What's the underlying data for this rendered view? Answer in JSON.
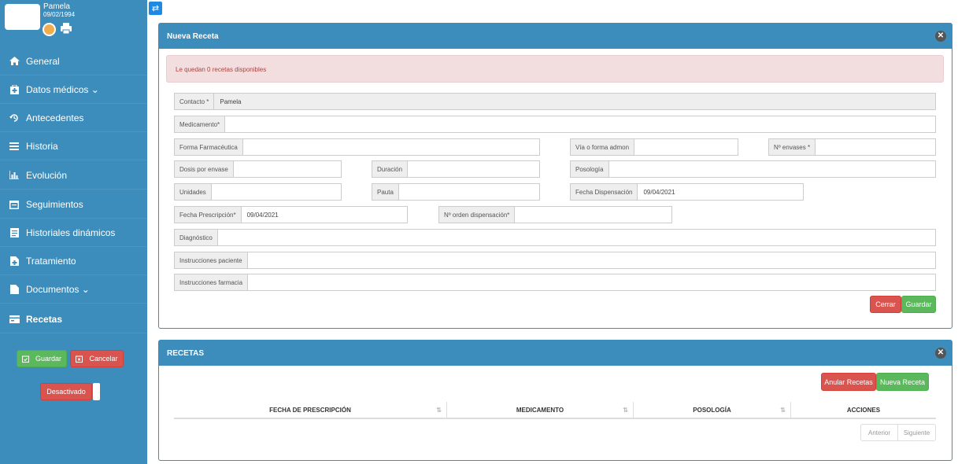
{
  "profile": {
    "name": "Pamela",
    "date": "09/02/1994",
    "icons": [
      "user-avatar-icon",
      "print-icon"
    ]
  },
  "toggle_sidebar_icon": "swap-icon",
  "nav": [
    {
      "label": "General",
      "icon": "home-icon",
      "active": false
    },
    {
      "label": "Datos médicos ⌄",
      "icon": "medical-briefcase-icon",
      "active": false
    },
    {
      "label": "Antecedentes",
      "icon": "history-icon",
      "active": false
    },
    {
      "label": "Historia",
      "icon": "list-icon",
      "active": false
    },
    {
      "label": "Evolución",
      "icon": "chart-icon",
      "active": false
    },
    {
      "label": "Seguimientos",
      "icon": "calendar-icon",
      "active": false
    },
    {
      "label": "Historiales dinámicos",
      "icon": "file-icon",
      "active": false
    },
    {
      "label": "Tratamiento",
      "icon": "file-plus-icon",
      "active": false
    },
    {
      "label": "Documentos ⌄",
      "icon": "document-icon",
      "active": false
    },
    {
      "label": "Recetas",
      "icon": "prescription-icon",
      "active": true
    }
  ],
  "sidebar_actions": {
    "save": "Guardar",
    "cancel": "Cancelar",
    "status": "Desactivado"
  },
  "nueva_receta": {
    "title": "Nueva Receta",
    "alert": "Le quedan 0 recetas disponibles",
    "fields": {
      "contacto": {
        "label": "Contacto *",
        "value": "Pamela"
      },
      "medicamento": {
        "label": "Medicamento*",
        "value": ""
      },
      "forma_farmaceutica": {
        "label": "Forma Farmacéutica",
        "value": ""
      },
      "via": {
        "label": "Vía o forma admon",
        "value": ""
      },
      "envases": {
        "label": "Nº envases *",
        "value": ""
      },
      "dosis": {
        "label": "Dosis por envase",
        "value": ""
      },
      "duracion": {
        "label": "Duración",
        "value": ""
      },
      "posologia": {
        "label": "Posología",
        "value": ""
      },
      "unidades": {
        "label": "Unidades",
        "value": ""
      },
      "pauta": {
        "label": "Pauta",
        "value": ""
      },
      "fecha_dispensacion": {
        "label": "Fecha Dispensación",
        "value": "09/04/2021"
      },
      "fecha_prescripcion": {
        "label": "Fecha Prescripción*",
        "value": "09/04/2021"
      },
      "orden_dispensacion": {
        "label": "Nº orden dispensación*",
        "value": ""
      },
      "diagnostico": {
        "label": "Diagnóstico",
        "value": ""
      },
      "instrucciones_paciente": {
        "label": "Instrucciones paciente",
        "value": ""
      },
      "instrucciones_farmacia": {
        "label": "Instrucciones farmacia",
        "value": ""
      }
    },
    "close_label": "Cerrar",
    "save_label": "Guardar"
  },
  "recetas": {
    "title": "RECETAS",
    "anular_label": "Anular Recetas",
    "nueva_label": "Nueva Receta",
    "columns": [
      "FECHA DE PRESCRIPCIÓN",
      "MEDICAMENTO",
      "POSOLOGÍA",
      "ACCIONES"
    ],
    "prev_label": "Anterior",
    "next_label": "Siguiente"
  },
  "colors": {
    "primary": "#3c8dbc",
    "success": "#5cb85c",
    "danger": "#d9534f",
    "alert_bg": "#f2dede"
  }
}
